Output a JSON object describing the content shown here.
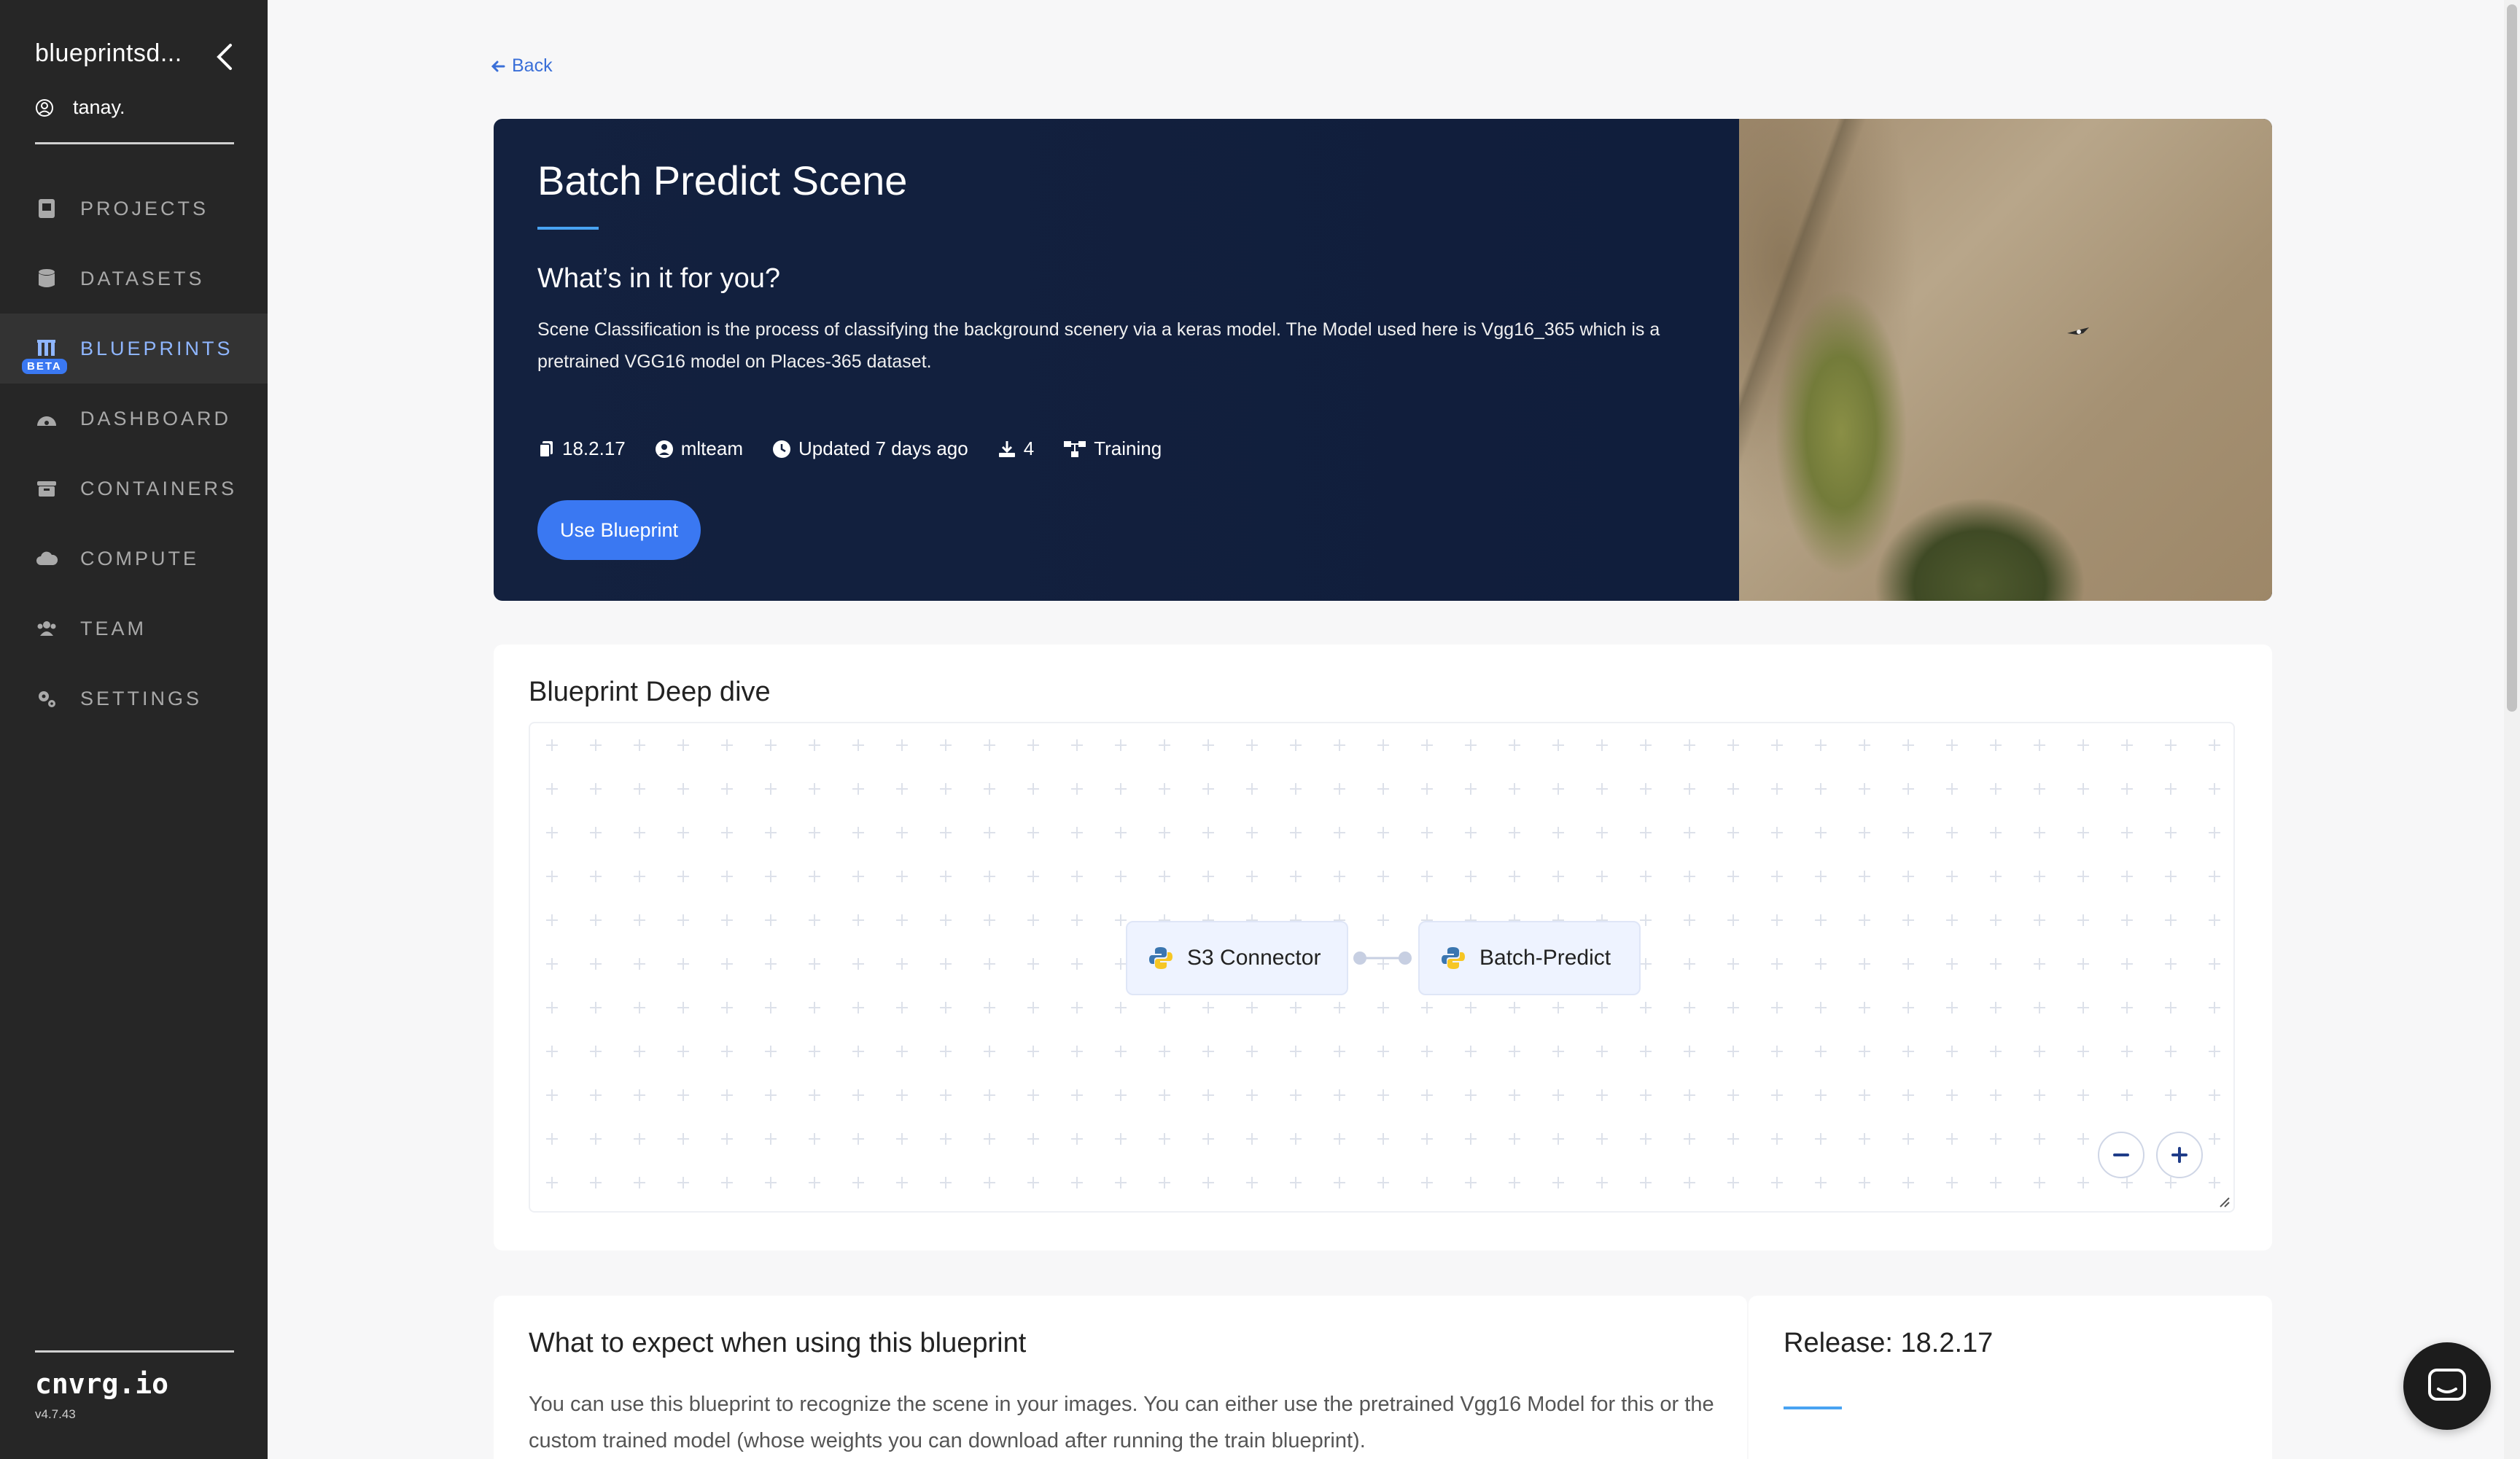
{
  "sidebar": {
    "org": "blueprintsd...",
    "user": "tanay.",
    "items": [
      {
        "label": "PROJECTS",
        "icon": "projects-icon"
      },
      {
        "label": "DATASETS",
        "icon": "datasets-icon"
      },
      {
        "label": "BLUEPRINTS",
        "icon": "blueprints-icon",
        "active": true,
        "badge": "BETA"
      },
      {
        "label": "DASHBOARD",
        "icon": "dashboard-icon"
      },
      {
        "label": "CONTAINERS",
        "icon": "containers-icon"
      },
      {
        "label": "COMPUTE",
        "icon": "cloud-icon"
      },
      {
        "label": "TEAM",
        "icon": "team-icon"
      },
      {
        "label": "SETTINGS",
        "icon": "settings-icon"
      }
    ],
    "brand": "cnvrg.io",
    "version": "v4.7.43"
  },
  "back_label": "Back",
  "hero": {
    "title": "Batch Predict Scene",
    "subtitle": "What’s in it for you?",
    "description": "Scene Classification is the process of classifying the background scenery via a keras model. The Model used here is Vgg16_365 which is a pretrained VGG16 model on Places-365 dataset.",
    "meta": {
      "version": "18.2.17",
      "author": "mlteam",
      "updated": "Updated 7 days ago",
      "downloads": "4",
      "type": "Training"
    },
    "button_label": "Use Blueprint"
  },
  "deep_dive": {
    "title": "Blueprint Deep dive",
    "nodes": [
      "S3 Connector",
      "Batch-Predict"
    ]
  },
  "expect": {
    "title": "What to expect when using this blueprint",
    "text": "You can use this blueprint to recognize the scene in your images. You can either use the pretrained Vgg16 Model for this or the custom trained model (whose weights you can download after running the train blueprint)."
  },
  "release": {
    "title": "Release: 18.2.17"
  },
  "colors": {
    "sidebar_bg": "#262626",
    "hero_bg": "#13213f",
    "accent": "#3a78f2",
    "active_nav": "#8fb6ff",
    "underline": "#49a3f2"
  }
}
